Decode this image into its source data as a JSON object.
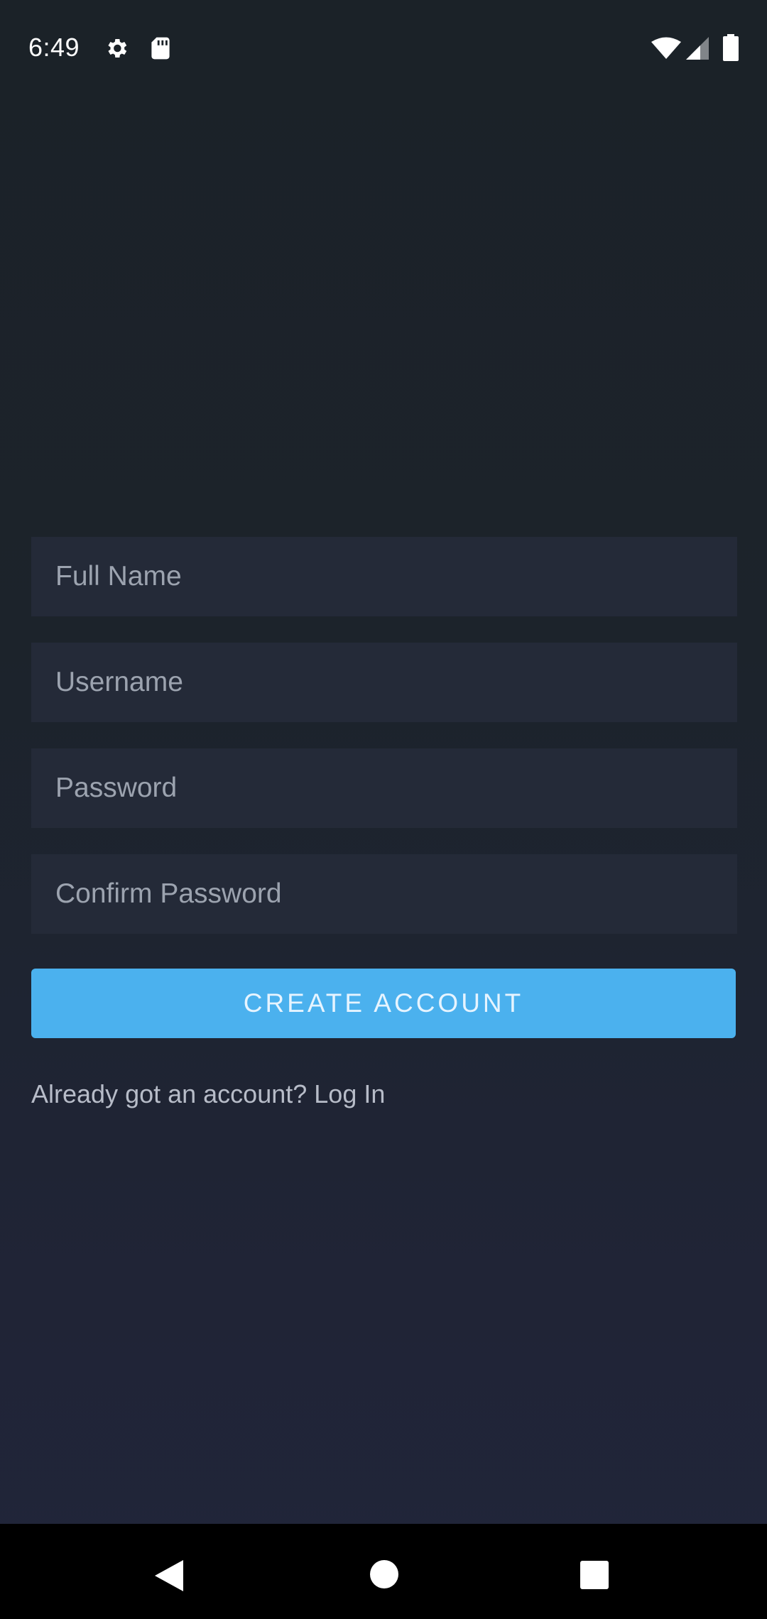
{
  "status_bar": {
    "time": "6:49",
    "icons": [
      "gear-icon",
      "sd-card-icon",
      "wifi-icon",
      "cell-signal-icon",
      "battery-icon"
    ]
  },
  "form": {
    "full_name_placeholder": "Full Name",
    "username_placeholder": "Username",
    "password_placeholder": "Password",
    "confirm_password_placeholder": "Confirm Password",
    "submit_label": "CREATE ACCOUNT"
  },
  "login": {
    "prompt": "Already got an account?",
    "link_label": "Log In"
  },
  "nav_bar": {
    "icons": [
      "back-icon",
      "home-icon",
      "recents-icon"
    ]
  },
  "colors": {
    "background": "#1c232b",
    "field": "#242a38",
    "accent": "#4bb1ee"
  }
}
